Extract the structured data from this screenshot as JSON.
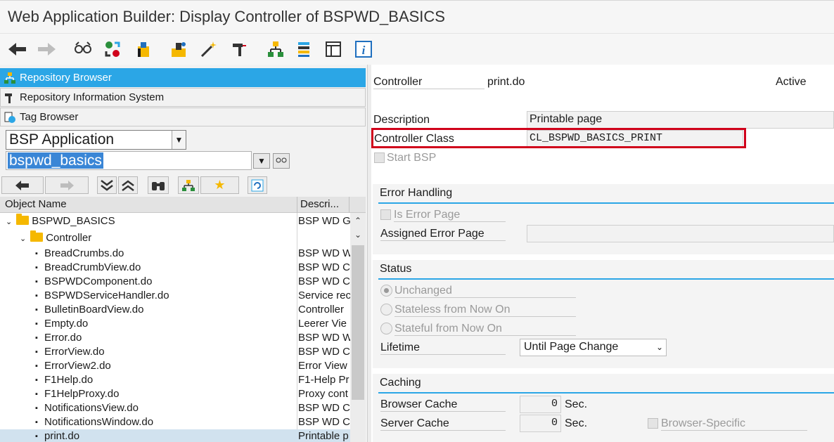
{
  "window": {
    "title": "Web Application Builder: Display Controller of BSPWD_BASICS"
  },
  "toolbar": {
    "icons": [
      "back-arrow-icon",
      "forward-arrow-icon",
      "glasses-icon",
      "objects-icon",
      "package-icon",
      "test-icon",
      "magic-wand-icon",
      "tool-icon",
      "hierarchy-icon",
      "stack-icon",
      "layout-icon",
      "info-icon"
    ]
  },
  "navigator": {
    "items": [
      {
        "label": "Repository Browser",
        "selected": true
      },
      {
        "label": "Repository Information System",
        "selected": false
      },
      {
        "label": "Tag Browser",
        "selected": false
      }
    ],
    "object_type": "BSP Application",
    "object_name": "bspwd_basics"
  },
  "tree": {
    "columns": {
      "name": "Object Name",
      "desc": "Descri..."
    },
    "root": {
      "name": "BSPWD_BASICS",
      "desc": "BSP WD G"
    },
    "folder": {
      "name": "Controller",
      "desc": ""
    },
    "items": [
      {
        "name": "BreadCrumbs.do",
        "desc": "BSP WD W"
      },
      {
        "name": "BreadCrumbView.do",
        "desc": "BSP WD C"
      },
      {
        "name": "BSPWDComponent.do",
        "desc": "BSP WD C"
      },
      {
        "name": "BSPWDServiceHandler.do",
        "desc": "Service rec"
      },
      {
        "name": "BulletinBoardView.do",
        "desc": "Controller"
      },
      {
        "name": "Empty.do",
        "desc": "Leerer Vie"
      },
      {
        "name": "Error.do",
        "desc": "BSP WD W"
      },
      {
        "name": "ErrorView.do",
        "desc": "BSP WD C"
      },
      {
        "name": "ErrorView2.do",
        "desc": "Error View"
      },
      {
        "name": "F1Help.do",
        "desc": "F1-Help Pr"
      },
      {
        "name": "F1HelpProxy.do",
        "desc": "Proxy cont"
      },
      {
        "name": "NotificationsView.do",
        "desc": "BSP WD C"
      },
      {
        "name": "NotificationsWindow.do",
        "desc": "BSP WD C"
      },
      {
        "name": "print.do",
        "desc": "Printable p"
      }
    ]
  },
  "controller": {
    "controller_label": "Controller",
    "controller_value": "print.do",
    "status": "Active",
    "description_label": "Description",
    "description_value": "Printable page",
    "class_label": "Controller Class",
    "class_value": "CL_BSPWD_BASICS_PRINT",
    "start_bsp_label": "Start BSP"
  },
  "error_handling": {
    "title": "Error Handling",
    "is_error_page_label": "Is Error Page",
    "assigned_error_page_label": "Assigned Error Page",
    "assigned_error_page_value": ""
  },
  "status_group": {
    "title": "Status",
    "options": [
      "Unchanged",
      "Stateless from Now On",
      "Stateful from Now On"
    ],
    "selected_option": "Unchanged",
    "lifetime_label": "Lifetime",
    "lifetime_value": "Until Page Change"
  },
  "caching": {
    "title": "Caching",
    "browser_cache_label": "Browser Cache",
    "browser_cache_value": "0",
    "server_cache_label": "Server Cache",
    "server_cache_value": "0",
    "unit": "Sec.",
    "browser_specific_label": "Browser-Specific"
  },
  "colors": {
    "accent": "#2ba6e6",
    "highlight": "#d0021b",
    "selection": "#d1e2ef"
  }
}
